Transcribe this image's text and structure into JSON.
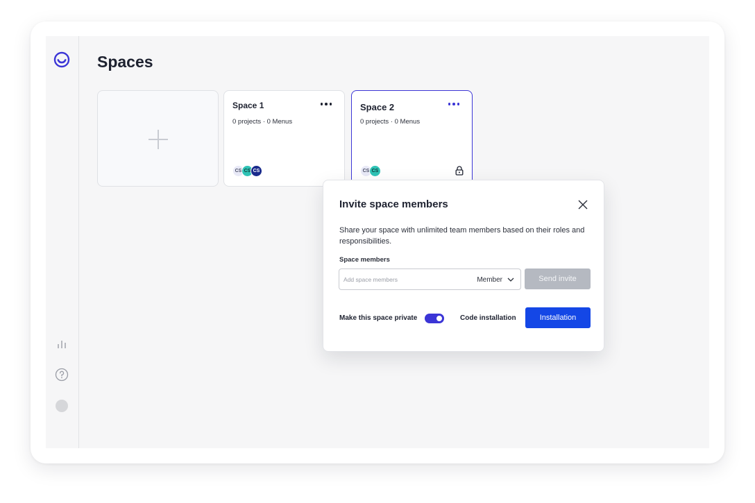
{
  "page": {
    "title": "Spaces"
  },
  "sidebar": {
    "icons": [
      "logo-icon",
      "analytics-icon",
      "help-icon",
      "user-avatar"
    ]
  },
  "spaces": [
    {
      "name": "Space 1",
      "meta": "0 projects · 0 Menus",
      "members": [
        "CS",
        "CS",
        "CS"
      ],
      "private": false
    },
    {
      "name": "Space 2",
      "meta": "0 projects · 0 Menus",
      "members": [
        "CS",
        "CS"
      ],
      "private": true
    }
  ],
  "modal": {
    "title": "Invite space members",
    "description": "Share your space with unlimited team members based on their roles and responsibilities.",
    "field_label": "Space members",
    "input_placeholder": "Add space members",
    "input_value": "",
    "role_selected": "Member",
    "send_label": "Send invite",
    "private_label": "Make this space private",
    "private_enabled": true,
    "code_label": "Code installation",
    "install_label": "Installation"
  },
  "colors": {
    "accent": "#3b35d6",
    "primary_button": "#1447e6",
    "disabled_button": "#b5b9c1",
    "avatar_teal": "#2fc3b6",
    "avatar_navy": "#1a2b8c"
  }
}
